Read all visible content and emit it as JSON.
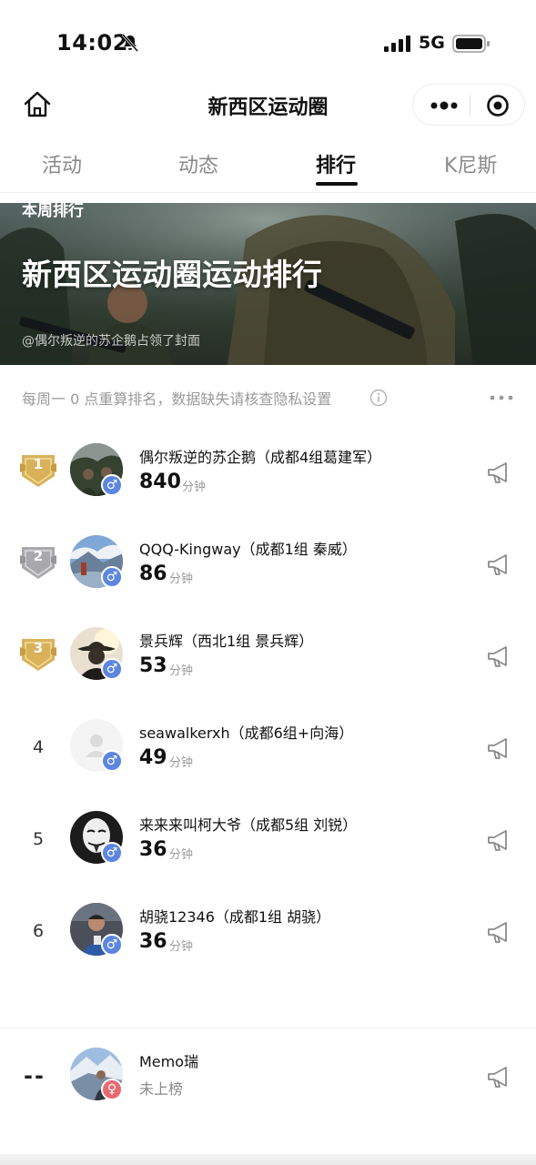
{
  "status_bar": {
    "time": "14:02",
    "network": "5G"
  },
  "nav": {
    "title": "新西区运动圈"
  },
  "tabs": [
    {
      "label": "活动",
      "active": false
    },
    {
      "label": "动态",
      "active": false
    },
    {
      "label": "排行",
      "active": true
    },
    {
      "label": "K尼斯",
      "active": false
    }
  ],
  "banner": {
    "tag": "本周排行",
    "title": "新西区运动圈运动排行",
    "credit": "@偶尔叛逆的苏企鹅占领了封面"
  },
  "info": {
    "text": "每周一 0 点重算排名，数据缺失请核查隐私设置"
  },
  "unit_label": "分钟",
  "rankings": [
    {
      "rank": "1",
      "medal": "gold",
      "name": "偶尔叛逆的苏企鹅（成都4组葛建军）",
      "score": "840",
      "gender": "male"
    },
    {
      "rank": "2",
      "medal": "silver",
      "name": "QQQ-Kingway（成都1组 秦威）",
      "score": "86",
      "gender": "male"
    },
    {
      "rank": "3",
      "medal": "bronze",
      "name": "景兵辉（西北1组 景兵辉）",
      "score": "53",
      "gender": "male"
    },
    {
      "rank": "4",
      "medal": "",
      "name": "seawalkerxh（成都6组+向海）",
      "score": "49",
      "gender": "male"
    },
    {
      "rank": "5",
      "medal": "",
      "name": "来来来叫柯大爷（成都5组 刘锐）",
      "score": "36",
      "gender": "male"
    },
    {
      "rank": "6",
      "medal": "",
      "name": "胡骁12346（成都1组 胡骁）",
      "score": "36",
      "gender": "male"
    }
  ],
  "self": {
    "rank": "--",
    "name": "Memo瑞",
    "status": "未上榜",
    "gender": "female"
  },
  "colors": {
    "gold": "#d8b15a",
    "silver": "#a9a9ad",
    "male": "#5c86e0",
    "female": "#e86a70"
  }
}
